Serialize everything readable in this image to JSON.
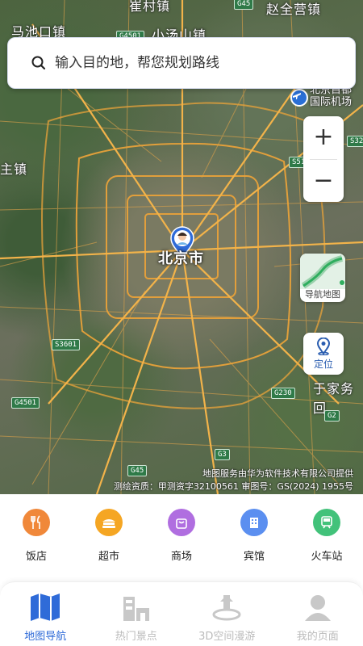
{
  "search": {
    "placeholder": "输入目的地，帮您规划路线"
  },
  "map": {
    "place_labels": {
      "top_left": "马池口镇",
      "top_center": "小汤山镇",
      "top_right": "赵全营镇",
      "top_partial": "崔村镇",
      "left": "主镇",
      "bottom_right": "于家务回"
    },
    "road_tags": {
      "g45_top": "G45",
      "g4501_top": "G4501",
      "s32": "S32",
      "s51": "S51",
      "s3601": "S3601",
      "g4501": "G4501",
      "g230": "G230",
      "g2": "G2",
      "g3": "G3",
      "g45": "G45"
    },
    "airport_label": "北京首都国际机场",
    "airport_label_line1": "北京首都",
    "airport_label_line2": "国际机场",
    "city_label": "北京市",
    "attribution_line1": "地图服务由华为软件技术有限公司提供",
    "attribution_line2": "测绘资质：甲测资字32100561  审图号：GS(2024) 1955号"
  },
  "controls": {
    "zoom_in": "+",
    "zoom_out": "−",
    "nav_map_label": "导航地图",
    "locate_label": "定位"
  },
  "categories": [
    {
      "label": "饭店",
      "icon": "restaurant-icon",
      "color": "#f0883a"
    },
    {
      "label": "超市",
      "icon": "supermarket-icon",
      "color": "#f5a623"
    },
    {
      "label": "商场",
      "icon": "mall-icon",
      "color": "#b06ee0"
    },
    {
      "label": "宾馆",
      "icon": "hotel-icon",
      "color": "#5b8ff0"
    },
    {
      "label": "火车站",
      "icon": "train-station-icon",
      "color": "#42c27a"
    }
  ],
  "bottom_nav": [
    {
      "label": "地图导航",
      "icon": "map-icon",
      "active": true
    },
    {
      "label": "热门景点",
      "icon": "attraction-icon",
      "active": false
    },
    {
      "label": "3D空间漫游",
      "icon": "vr-3d-icon",
      "active": false
    },
    {
      "label": "我的页面",
      "icon": "profile-icon",
      "active": false
    }
  ],
  "colors": {
    "accent": "#2f6bd8",
    "inactive": "#bbbbbb",
    "ring_road": "#e8a23a"
  }
}
